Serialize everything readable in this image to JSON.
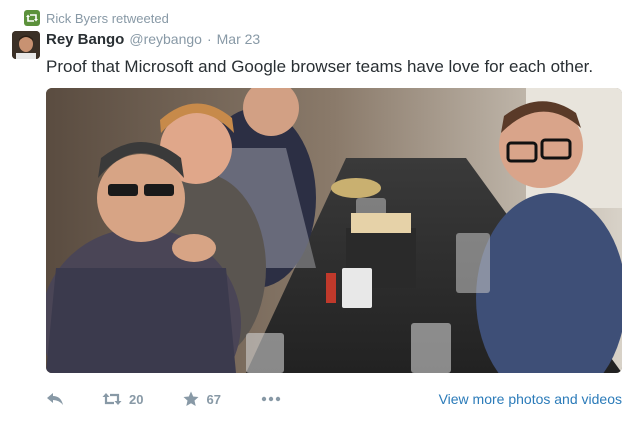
{
  "retweet_context": {
    "text": "Rick Byers retweeted",
    "icon": "retweet-icon",
    "accent": "#5c913b"
  },
  "tweet": {
    "author_name": "Rey Bango",
    "handle": "@reybango",
    "separator": "·",
    "date": "Mar 23",
    "text": "Proof that Microsoft and Google browser teams have love for each other."
  },
  "media": {
    "description_icon": "photo"
  },
  "actions": {
    "reply_icon": "reply-icon",
    "retweet_count": "20",
    "favorite_count": "67",
    "more_icon": "more-icon",
    "view_more": "View more photos and videos"
  },
  "colors": {
    "link": "#2b7bb9",
    "muted": "#8899a6",
    "text": "#292f33"
  }
}
